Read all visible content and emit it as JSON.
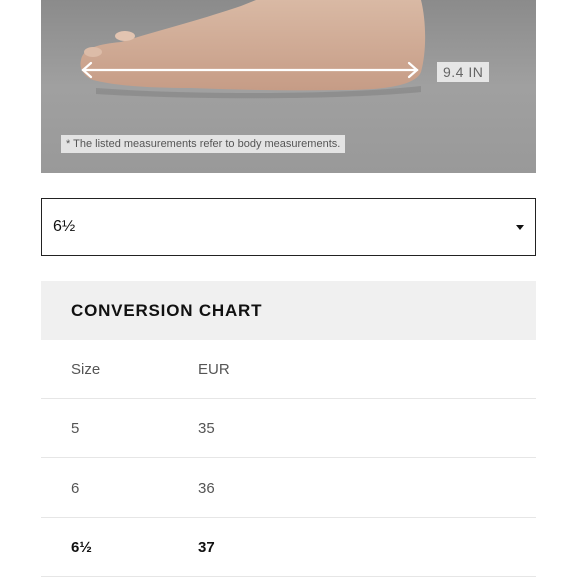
{
  "photo": {
    "measurement": "9.4 IN",
    "note": "* The listed measurements refer to body measurements."
  },
  "size_select": {
    "selected": "6½",
    "caret_icon": "caret-down-icon"
  },
  "conversion_chart": {
    "title": "CONVERSION CHART",
    "header": {
      "size": "Size",
      "eur": "EUR"
    },
    "rows": [
      {
        "size": "5",
        "eur": "35"
      },
      {
        "size": "6",
        "eur": "36"
      },
      {
        "size": "6½",
        "eur": "37",
        "selected": true
      }
    ]
  }
}
